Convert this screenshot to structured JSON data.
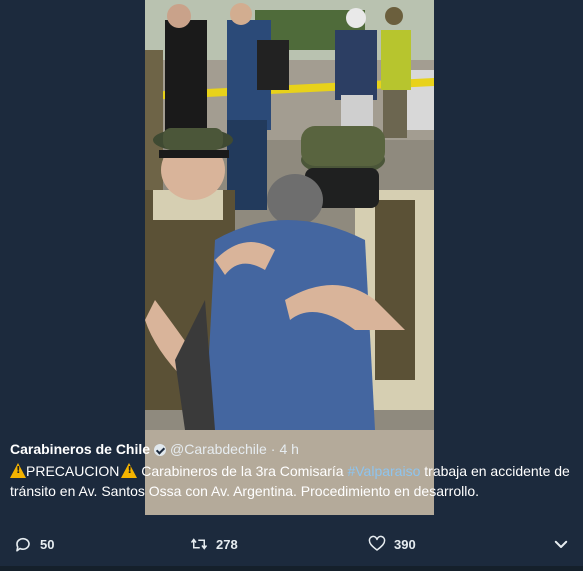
{
  "tweet": {
    "author_name": "Carabineros de Chile",
    "handle": "@Carabdechile",
    "separator": "·",
    "time": "4 h",
    "text_part1": "PRECAUCION",
    "text_part2": " Carabineros de la 3ra Comisaría ",
    "hashtag": "#Valparaiso",
    "text_part3": " trabaja en accidente de tránsito en Av. Santos Ossa con Av. Argentina. Procedimiento en desarrollo."
  },
  "actions": {
    "replies": "50",
    "retweets": "278",
    "likes": "390"
  },
  "icons": {
    "reply": "reply-icon",
    "retweet": "retweet-icon",
    "like": "heart-icon",
    "more": "chevron-down-icon",
    "verified": "verified-badge-icon",
    "warning": "warning-icon"
  },
  "colors": {
    "background": "#1c2a3d",
    "text": "#ffffff",
    "hashtag": "#8ec4ee",
    "warning": "#f5b400"
  }
}
